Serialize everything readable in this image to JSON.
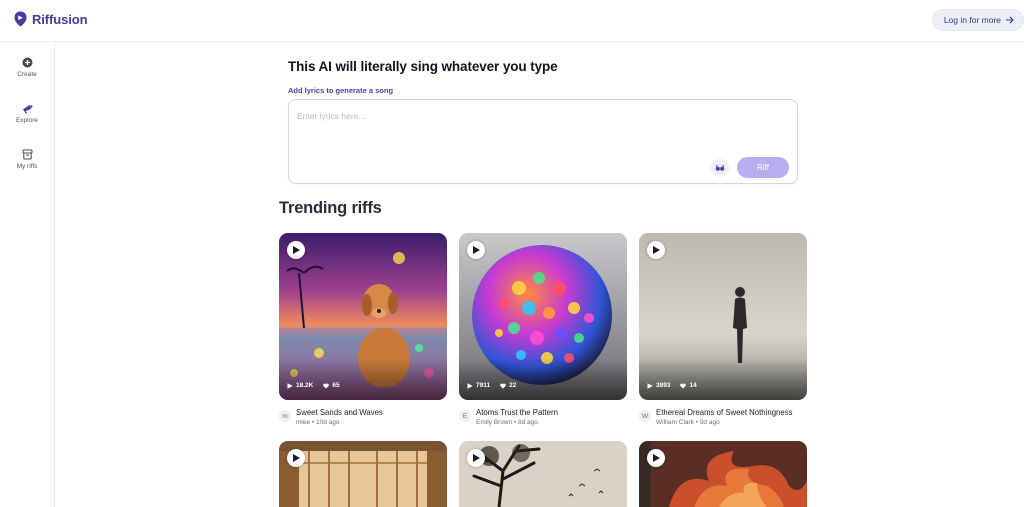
{
  "header": {
    "brand": "Riffusion",
    "login_label": "Log in for more"
  },
  "sidebar": {
    "items": [
      {
        "label": "Create",
        "icon": "plus-circle-icon"
      },
      {
        "label": "Explore",
        "icon": "megaphone-icon"
      },
      {
        "label": "My riffs",
        "icon": "archive-box-icon"
      }
    ]
  },
  "hero": {
    "title": "This AI will literally sing whatever you type",
    "subtitle": "Add lyrics to generate a song",
    "placeholder": "Enter lyrics here...",
    "riff_label": "Riff",
    "mode_icon": "glasses-icon"
  },
  "trending": {
    "title": "Trending riffs",
    "cards": [
      {
        "title": "Sweet Sands and Waves",
        "avatar": "m",
        "author": "mlee",
        "age": "10d ago",
        "plays": "18.2K",
        "likes": "65",
        "scene": "dog-on-beach"
      },
      {
        "title": "Atoms Trust the Pattern",
        "avatar": "E",
        "author": "Emily Brown",
        "age": "8d ago",
        "plays": "7911",
        "likes": "22",
        "scene": "colorful-sphere"
      },
      {
        "title": "Ethereal Dreams of Sweet Nothingness",
        "avatar": "W",
        "author": "William Clark",
        "age": "9d ago",
        "plays": "3893",
        "likes": "14",
        "scene": "figure-in-fog"
      },
      {
        "scene": "grand-hall"
      },
      {
        "scene": "dark-tree"
      },
      {
        "scene": "fire"
      }
    ]
  },
  "colors": {
    "brand": "#4a3b9e",
    "riff_button": "#b7aef0",
    "login_bg": "#eceef8"
  }
}
